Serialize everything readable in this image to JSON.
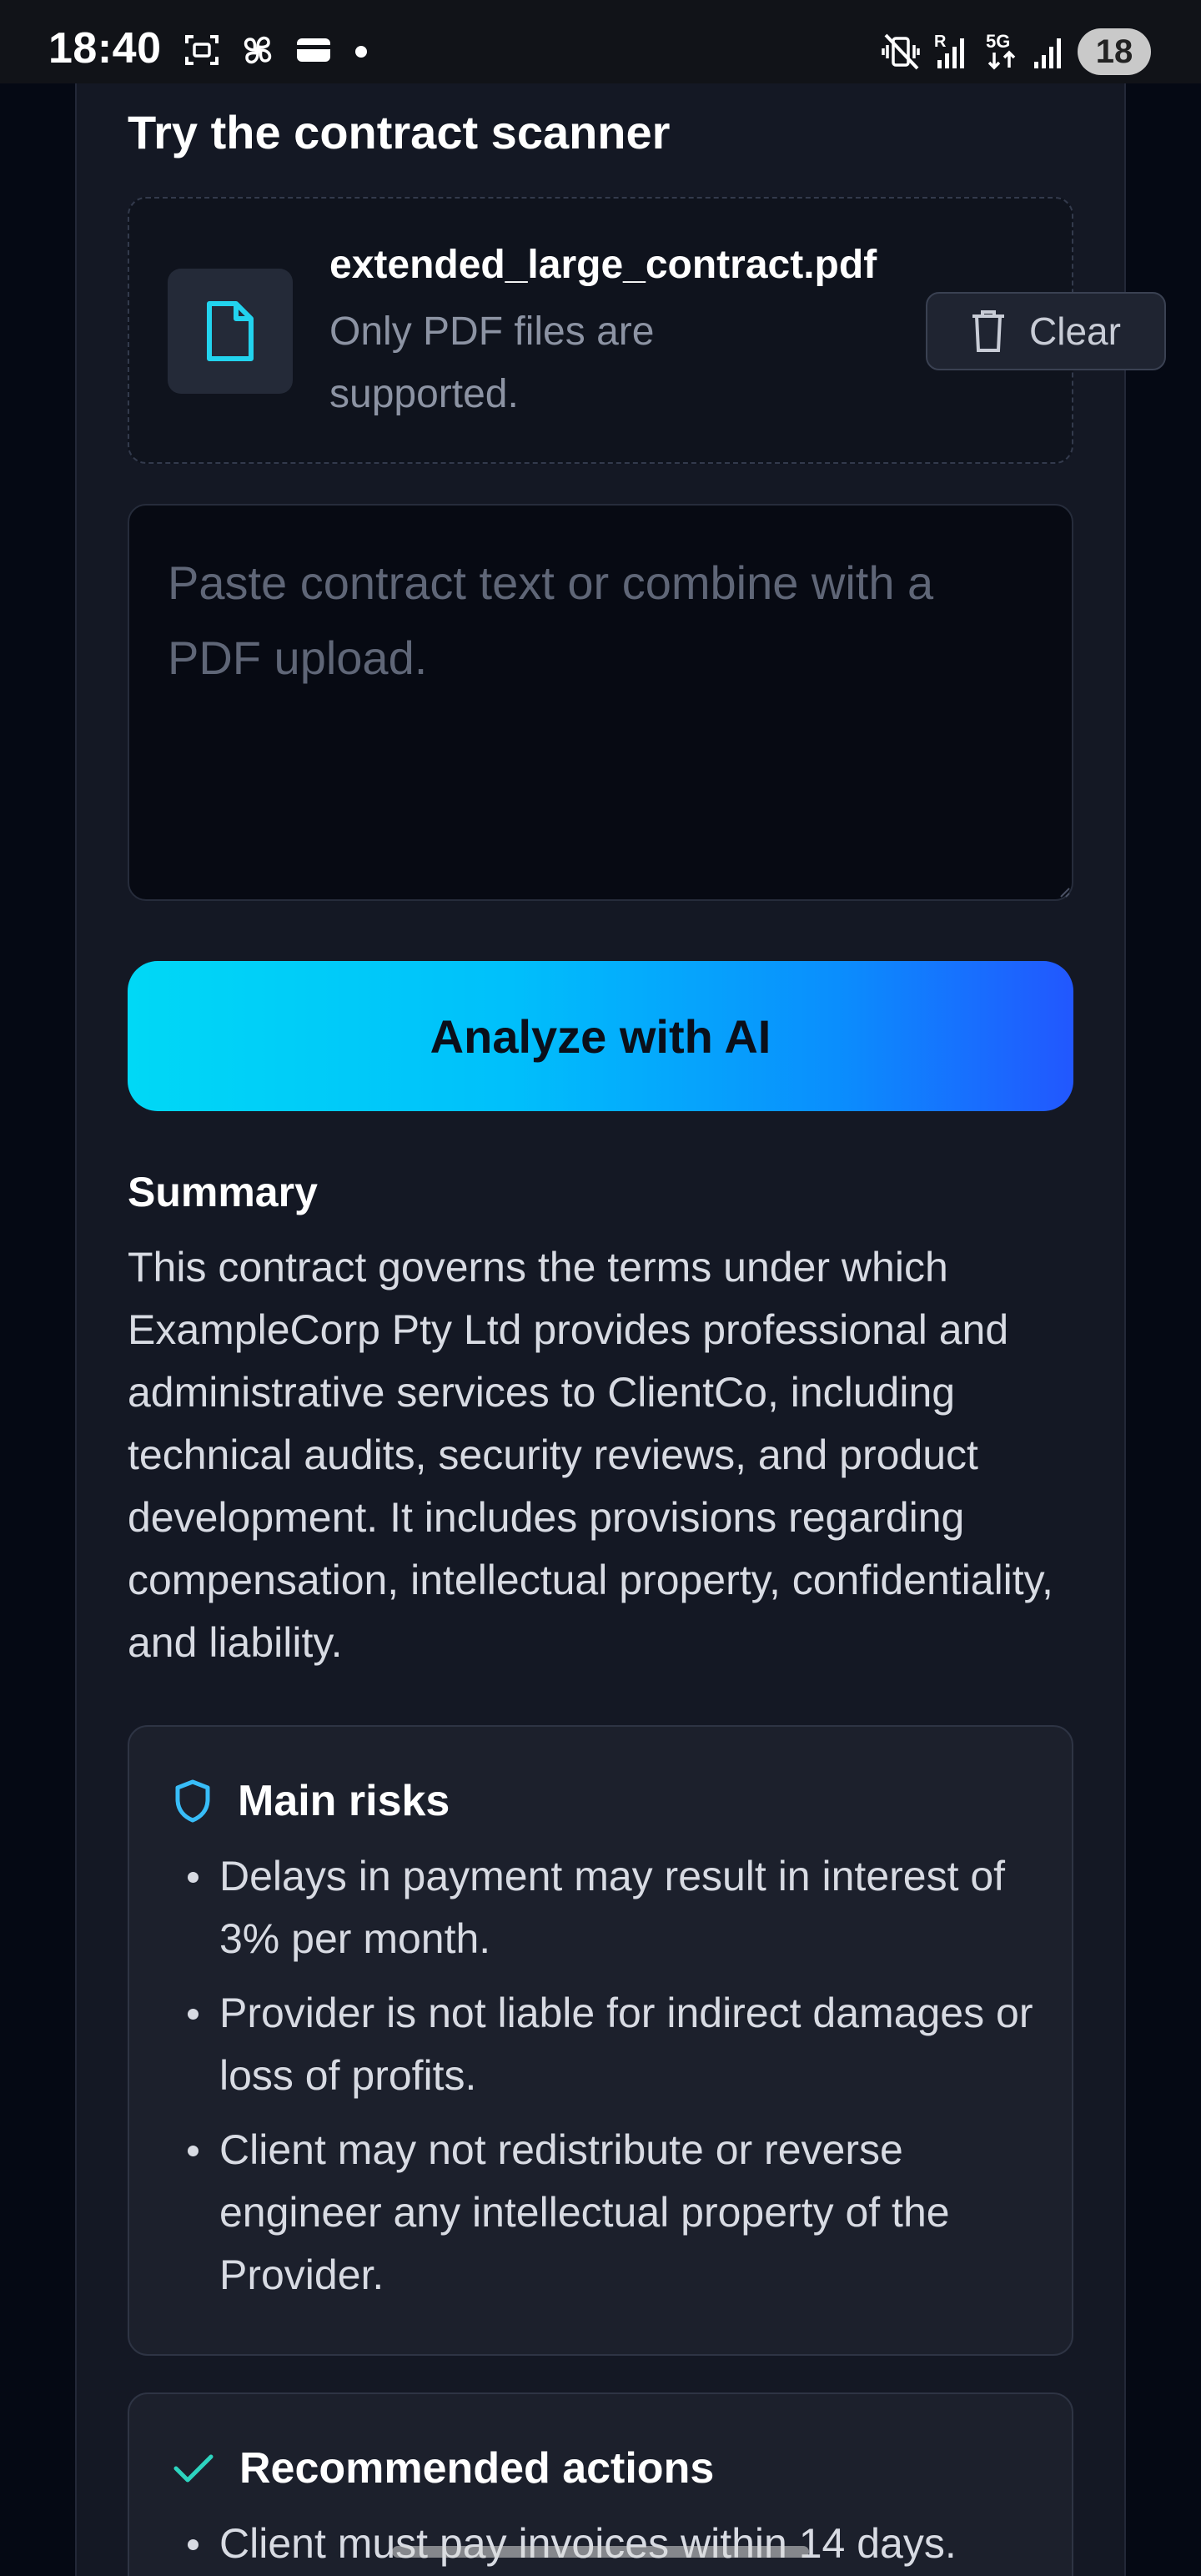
{
  "status_bar": {
    "time": "18:40",
    "left_icons": [
      "screenshot-icon",
      "pinwheel-icon",
      "wallet-icon",
      "dot-icon"
    ],
    "right_icons": [
      "vibrate-mute-icon",
      "signal-r-icon",
      "5g-icon",
      "signal-icon"
    ],
    "battery": "18"
  },
  "scanner": {
    "title": "Try the contract scanner",
    "file_name": "extended_large_contract.pdf",
    "file_hint": "Only PDF files are supported.",
    "clear_label": "Clear",
    "textarea_placeholder": "Paste contract text or combine with a PDF upload.",
    "analyze_label": "Analyze with AI"
  },
  "summary": {
    "heading": "Summary",
    "text": "This contract governs the terms under which ExampleCorp Pty Ltd provides professional and administrative services to ClientCo, including technical audits, security reviews, and product development. It includes provisions regarding compensation, intellectual property, confidentiality, and liability."
  },
  "risks": {
    "title": "Main risks",
    "items": [
      "Delays in payment may result in interest of 3% per month.",
      "Provider is not liable for indirect damages or loss of profits.",
      "Client may not redistribute or reverse engineer any intellectual property of the Provider."
    ]
  },
  "actions": {
    "title": "Recommended actions",
    "items": [
      "Client must pay invoices within 14 days."
    ]
  },
  "colors": {
    "accent_cyan": "#00d8f6",
    "accent_blue": "#2257fe",
    "background": "#050914",
    "card": "#141824"
  }
}
